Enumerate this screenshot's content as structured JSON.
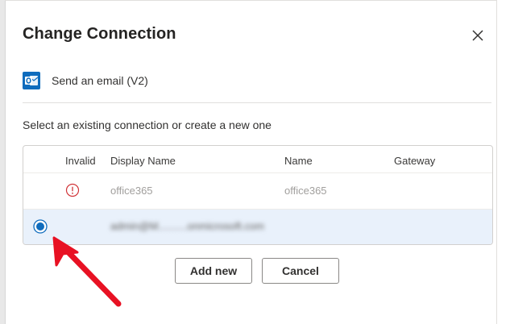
{
  "dialog": {
    "title": "Change Connection",
    "action_name": "Send an email (V2)",
    "prompt": "Select an existing connection or create a new one"
  },
  "table": {
    "headers": {
      "invalid": "Invalid",
      "display_name": "Display Name",
      "name": "Name",
      "gateway": "Gateway"
    },
    "rows": [
      {
        "invalid_icon": "warning-circle-icon",
        "display_name": "office365",
        "name": "office365",
        "gateway": "",
        "selected": false
      },
      {
        "display_name_redacted": "admin@M..........onmicrosoft.com",
        "selected": true
      }
    ]
  },
  "buttons": {
    "add_new": "Add new",
    "cancel": "Cancel"
  },
  "icons": {
    "close": "close-icon",
    "action": "outlook-icon",
    "annotation": "red-arrow-annotation"
  },
  "colors": {
    "accent": "#0f6cbd",
    "selected_row": "#e9f1fb",
    "warning": "#d13438",
    "annotation": "#e81123"
  }
}
